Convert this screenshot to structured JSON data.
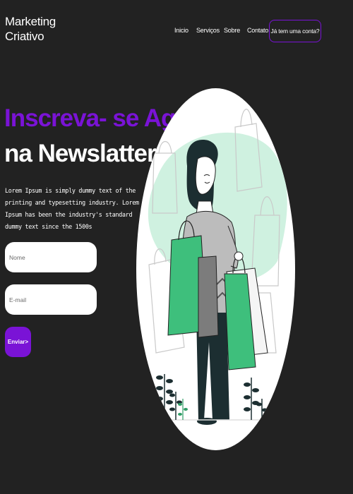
{
  "logo": {
    "line1": "Marketing",
    "line2": "Criativo"
  },
  "nav": {
    "items": [
      "Inicio",
      "Serviços",
      "Sobre",
      "Contato"
    ],
    "account_button": "Já tem uma conta?"
  },
  "hero": {
    "title_line1": "Inscreva- se Agora",
    "title_line2": "na Newslatter",
    "description": "Lorem Ipsum is simply dummy text of the printing and typesetting industry. Lorem Ipsum has been the industry's standard dummy text since the 1500s"
  },
  "form": {
    "name_placeholder": "Nome",
    "email_placeholder": "E-mail",
    "submit_label": "Enviar>"
  },
  "illustration": {
    "icon": "shopping-woman-illustration"
  },
  "colors": {
    "accent": "#7a13d6",
    "background": "#222222",
    "illustration_green": "#3ebf7c",
    "illustration_mint": "#cff1e0"
  }
}
